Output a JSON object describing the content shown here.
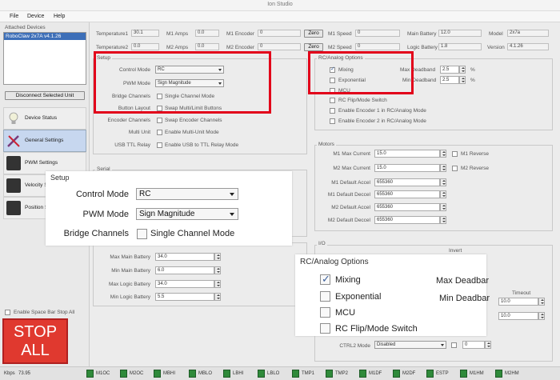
{
  "window": {
    "title": "Ion Studio"
  },
  "menu": [
    "File",
    "Device",
    "Help"
  ],
  "left": {
    "attached_label": "Attached Devices",
    "device": "RoboClaw 2x7A v4.1.26",
    "disconnect": "Disconnect Selected Unit",
    "nav": [
      "Device Status",
      "General Settings",
      "PWM Settings",
      "Velocity Settings",
      "Position Settings"
    ],
    "space_stop": "Enable Space Bar Stop All",
    "stop_all": "STOP ALL"
  },
  "top": {
    "temperature1": {
      "label": "Temperature1",
      "value": "30.1"
    },
    "temperature2": {
      "label": "Temperature2",
      "value": "0.0"
    },
    "m1_amps": {
      "label": "M1 Amps",
      "value": "0.0"
    },
    "m2_amps": {
      "label": "M2 Amps",
      "value": "0.0"
    },
    "m1_encoder": {
      "label": "M1 Encoder",
      "value": "0"
    },
    "m2_encoder": {
      "label": "M2 Encoder",
      "value": "0"
    },
    "zero": "Zero",
    "m1_speed": {
      "label": "M1 Speed",
      "value": "0"
    },
    "m2_speed": {
      "label": "M2 Speed",
      "value": "0"
    },
    "main_battery": {
      "label": "Main Battery",
      "value": "12.0"
    },
    "logic_battery": {
      "label": "Logic Battery",
      "value": "1.8"
    },
    "model": {
      "label": "Model",
      "value": "2x7a"
    },
    "version": {
      "label": "Version",
      "value": "4.1.26"
    }
  },
  "setup": {
    "title": "Setup",
    "control_mode": {
      "label": "Control Mode",
      "value": "RC"
    },
    "pwm_mode": {
      "label": "PWM Mode",
      "value": "Sign Magnitude"
    },
    "bridge": {
      "label": "Bridge Channels",
      "option": "Single Channel Mode"
    },
    "button_layout": {
      "label": "Button Layout",
      "option": "Swap Multi/Limit Buttons"
    },
    "encoder_channels": {
      "label": "Encoder Channels",
      "option": "Swap Encoder Channels"
    },
    "multi_unit": {
      "label": "Multi Unit",
      "option": "Enable Multi-Unit Mode"
    },
    "usb_ttl": {
      "label": "USB TTL Relay",
      "option": "Enable USB to TTL Relay Mode"
    }
  },
  "rc": {
    "title": "RC/Analog Options",
    "options": [
      {
        "label": "Mixing",
        "checked": true
      },
      {
        "label": "Exponential",
        "checked": false
      },
      {
        "label": "MCU",
        "checked": false
      },
      {
        "label": "RC Flip/Mode Switch",
        "checked": false
      },
      {
        "label": "Enable Encoder 1 in RC/Analog Mode",
        "checked": false
      },
      {
        "label": "Enable Encoder 2 in RC/Analog Mode",
        "checked": false
      }
    ],
    "max_deadband": {
      "label": "Max Deadband",
      "value": "2.5",
      "unit": "%"
    },
    "min_deadband": {
      "label": "Min Deadband",
      "value": "2.5",
      "unit": "%"
    }
  },
  "serial": {
    "title": "Serial"
  },
  "motors": {
    "title": "Motors",
    "rows": [
      {
        "label": "M1 Max Current",
        "value": "15.0"
      },
      {
        "label": "M2 Max Current",
        "value": "15.0"
      },
      {
        "label": "M1 Default Accel",
        "value": "655360"
      },
      {
        "label": "M1 Default Deccel",
        "value": "655360"
      },
      {
        "label": "M2 Default Accel",
        "value": "655360"
      },
      {
        "label": "M2 Default Deccel",
        "value": "655360"
      }
    ],
    "m1_reverse": "M1 Reverse",
    "m2_reverse": "M2 Reverse"
  },
  "battery": {
    "rows": [
      {
        "label": "Max Main Battery",
        "value": "34.0"
      },
      {
        "label": "Min Main Battery",
        "value": "6.0"
      },
      {
        "label": "Max Logic Battery",
        "value": "34.0"
      },
      {
        "label": "Min Logic Battery",
        "value": "5.5"
      }
    ]
  },
  "io": {
    "title": "I/O",
    "invert": "Invert",
    "timeout": "Timeout",
    "timeout1": "10.0",
    "timeout2": "10.0",
    "ctrl2_label": "CTRL2 Mode",
    "ctrl2_value": "Disabled",
    "ctrl2_num": "0"
  },
  "zoom_setup": {
    "title": "Setup",
    "control_mode": {
      "label": "Control Mode",
      "value": "RC"
    },
    "pwm_mode": {
      "label": "PWM Mode",
      "value": "Sign Magnitude"
    },
    "bridge": {
      "label": "Bridge Channels",
      "option": "Single Channel Mode"
    }
  },
  "zoom_rc": {
    "title": "RC/Analog Options",
    "options": [
      {
        "label": "Mixing",
        "checked": true
      },
      {
        "label": "Exponential",
        "checked": false
      },
      {
        "label": "MCU",
        "checked": false
      },
      {
        "label": "RC Flip/Mode Switch",
        "checked": false
      }
    ],
    "max_deadband": "Max Deadbar",
    "min_deadband": "Min Deadbar"
  },
  "statusbar": {
    "kbps_label": "Kbps",
    "kbps_value": "73.95",
    "leds": [
      "M1OC",
      "M2OC",
      "MBHI",
      "MBLO",
      "LBHI",
      "LBLO",
      "TMP1",
      "TMP2",
      "M1DF",
      "M2DF",
      "ESTP",
      "M1HM",
      "M2HM"
    ]
  }
}
